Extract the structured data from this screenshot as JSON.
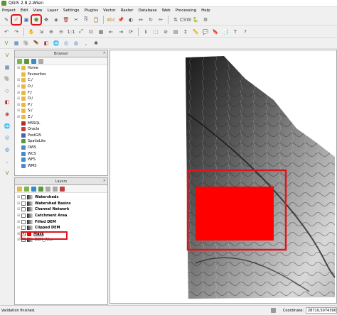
{
  "window": {
    "title": "QGIS 2.8.2-Wien"
  },
  "menu": [
    "Project",
    "Edit",
    "View",
    "Layer",
    "Settings",
    "Plugins",
    "Vector",
    "Raster",
    "Database",
    "Web",
    "Processing",
    "Help"
  ],
  "colors": {
    "highlight": "#e0141e",
    "mask_fill": "#ff0000",
    "qgis_green": "#589632"
  },
  "browser": {
    "title": "Browser",
    "items": [
      {
        "label": "Home",
        "icon": "folder-icon",
        "color": "#e9b948"
      },
      {
        "label": "Favourites",
        "icon": "star-folder-icon",
        "color": "#e9b948"
      },
      {
        "label": "C:/",
        "icon": "drive-icon",
        "color": "#e9b948"
      },
      {
        "label": "D:/",
        "icon": "drive-icon",
        "color": "#e9b948"
      },
      {
        "label": "F:/",
        "icon": "drive-icon",
        "color": "#e9b948"
      },
      {
        "label": "O:/",
        "icon": "drive-icon",
        "color": "#e9b948"
      },
      {
        "label": "P:/",
        "icon": "drive-icon",
        "color": "#e9b948"
      },
      {
        "label": "S:/",
        "icon": "drive-icon",
        "color": "#e9b948"
      },
      {
        "label": "Z:/",
        "icon": "drive-icon",
        "color": "#e9b948"
      },
      {
        "label": "MSSQL",
        "icon": "mssql-icon",
        "color": "#b03030"
      },
      {
        "label": "Oracle",
        "icon": "oracle-icon",
        "color": "#c04040"
      },
      {
        "label": "PostGIS",
        "icon": "postgis-icon",
        "color": "#3a6ea5"
      },
      {
        "label": "SpatiaLite",
        "icon": "spatialite-icon",
        "color": "#5a9a3a"
      },
      {
        "label": "OWS",
        "icon": "ows-icon",
        "color": "#4a8ac8"
      },
      {
        "label": "WCS",
        "icon": "wcs-icon",
        "color": "#4a8ac8"
      },
      {
        "label": "WFS",
        "icon": "wfs-icon",
        "color": "#4a8ac8"
      },
      {
        "label": "WMS",
        "icon": "wms-icon",
        "color": "#4a8ac8"
      }
    ]
  },
  "layers": {
    "title": "Layers",
    "items": [
      {
        "label": "Watersheds",
        "type": "raster"
      },
      {
        "label": "Watershed Basins",
        "type": "raster"
      },
      {
        "label": "Channel Network",
        "type": "raster"
      },
      {
        "label": "Catchment Area",
        "type": "raster"
      },
      {
        "label": "Filled DEM",
        "type": "raster"
      },
      {
        "label": "Clipped DEM",
        "type": "raster"
      },
      {
        "label": "Mask",
        "type": "vector"
      },
      {
        "label": "DEM_Wien",
        "type": "raster"
      }
    ]
  },
  "status": {
    "message": "Validation finished.",
    "coordinate_label": "Coordinate:",
    "coordinate_value": "28710,5074390"
  }
}
